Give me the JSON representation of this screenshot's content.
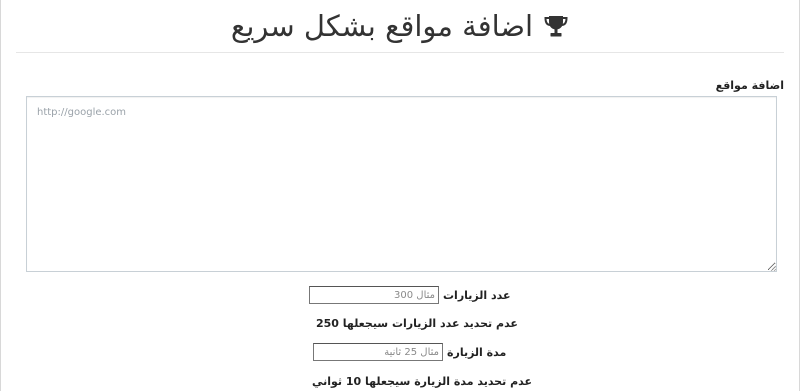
{
  "header": {
    "title": "اضافة مواقع بشكل سريع",
    "icon": "trophy-icon"
  },
  "sites": {
    "label": "اضافة مواقع",
    "placeholder": "http://google.com",
    "value": ""
  },
  "visits": {
    "label": "عدد الزيارات",
    "placeholder": "مثال 300",
    "value": "",
    "note": "عدم تحديد عدد الزيارات سيجعلها 250"
  },
  "duration": {
    "label": "مدة الزيارة",
    "placeholder": "مثال 25 ثانية",
    "value": "",
    "note": "عدم تحديد مدة الزيارة سيجعلها 10 ثواني"
  },
  "colors": {
    "text": "#333333",
    "border": "#c8d0d6"
  }
}
